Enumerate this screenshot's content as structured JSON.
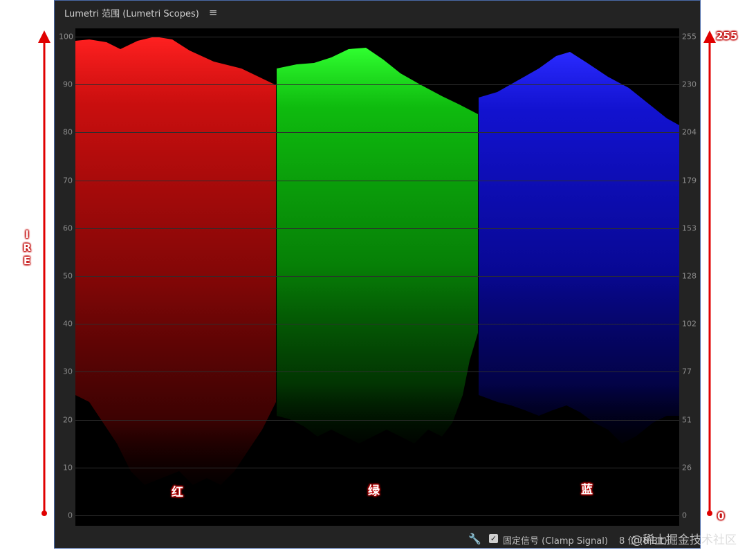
{
  "panel": {
    "title": "Lumetri 范围 (Lumetri Scopes)",
    "menu_icon": "hamburger-menu-icon"
  },
  "scope": {
    "left_axis": [
      "100",
      "90",
      "80",
      "70",
      "60",
      "50",
      "40",
      "30",
      "20",
      "10",
      "0"
    ],
    "right_axis": [
      "255",
      "230",
      "204",
      "179",
      "153",
      "128",
      "102",
      "77",
      "51",
      "26",
      "0"
    ],
    "channels": [
      {
        "label": "红",
        "color": "#ff1a1a"
      },
      {
        "label": "绿",
        "color": "#1aff1a"
      },
      {
        "label": "蓝",
        "color": "#1a1aff"
      }
    ]
  },
  "footer": {
    "wrench_icon": "wrench-icon",
    "clamp_checked": true,
    "clamp_label": "固定信号 (Clamp Signal)",
    "bit_depth": "8 位 (8 Bit)"
  },
  "annotations": {
    "ire_letters": [
      "I",
      "R",
      "E"
    ],
    "top_right": "255",
    "bottom_right": "0",
    "arrow_color": "#e00000"
  },
  "watermark": "@稀土掘金技术社区"
}
